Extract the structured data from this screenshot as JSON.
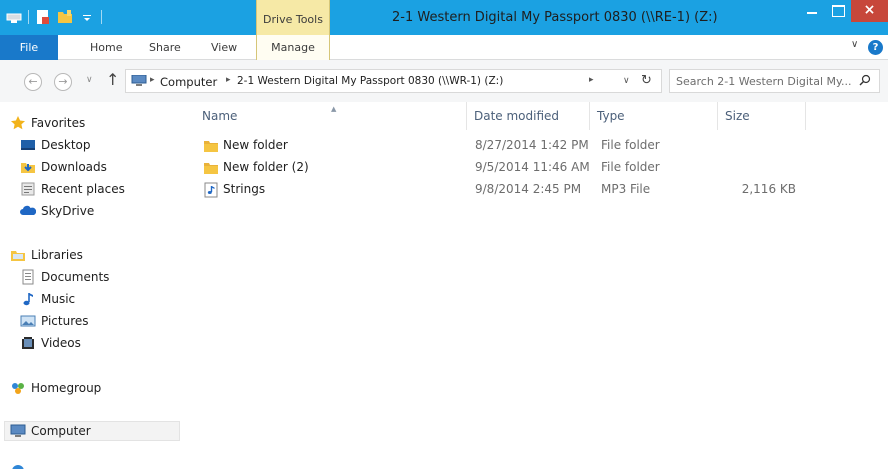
{
  "window": {
    "title": "2-1 Western Digital My Passport 0830 (\\\\RE-1) (Z:)",
    "contextual_tab": "Drive Tools",
    "close_glyph": "×",
    "accent_color": "#1ba1e2"
  },
  "ribbon": {
    "tabs": [
      "File",
      "Home",
      "Share",
      "View",
      "Manage"
    ],
    "chevron": "∨",
    "help": "?"
  },
  "address": {
    "back": "←",
    "forward": "→",
    "up": "↑",
    "crumbs": [
      "Computer",
      "2-1 Western Digital My Passport 0830 (\\\\WR-1) (Z:)"
    ],
    "separator": "▸",
    "dropdown": "∨",
    "refresh": "↻"
  },
  "search": {
    "placeholder": "Search 2-1 Western Digital My..."
  },
  "navpane": {
    "favorites": {
      "label": "Favorites",
      "items": [
        "Desktop",
        "Downloads",
        "Recent places",
        "SkyDrive"
      ]
    },
    "libraries": {
      "label": "Libraries",
      "items": [
        "Documents",
        "Music",
        "Pictures",
        "Videos"
      ]
    },
    "homegroup": "Homegroup",
    "computer": "Computer"
  },
  "columns": [
    "Name",
    "Date modified",
    "Type",
    "Size"
  ],
  "files": [
    {
      "name": "New folder",
      "date": "8/27/2014 1:42 PM",
      "type": "File folder",
      "size": "",
      "icon": "folder-icon"
    },
    {
      "name": "New folder (2)",
      "date": "9/5/2014 11:46 AM",
      "type": "File folder",
      "size": "",
      "icon": "folder-icon"
    },
    {
      "name": "Strings",
      "date": "9/8/2014 2:45 PM",
      "type": "MP3 File",
      "size": "2,116 KB",
      "icon": "mp3-file-icon"
    }
  ]
}
